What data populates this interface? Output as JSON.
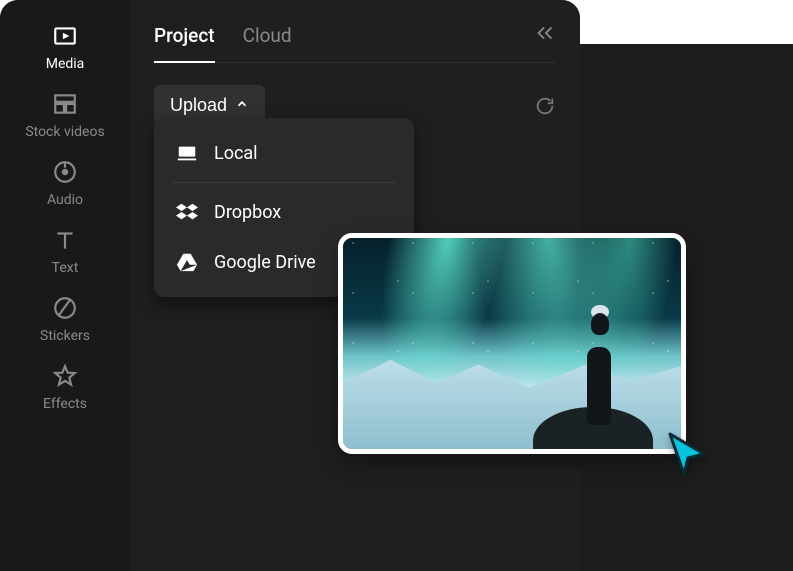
{
  "sidebar": {
    "items": [
      {
        "label": "Media",
        "icon": "media-icon",
        "active": true
      },
      {
        "label": "Stock videos",
        "icon": "stock-icon"
      },
      {
        "label": "Audio",
        "icon": "audio-icon"
      },
      {
        "label": "Text",
        "icon": "text-icon"
      },
      {
        "label": "Stickers",
        "icon": "stickers-icon"
      },
      {
        "label": "Effects",
        "icon": "effects-icon"
      }
    ]
  },
  "tabs": {
    "project": "Project",
    "cloud": "Cloud"
  },
  "toolbar": {
    "upload_label": "Upload"
  },
  "upload_menu": {
    "local": "Local",
    "dropbox": "Dropbox",
    "google_drive": "Google Drive"
  },
  "preview": {
    "alt": "aurora-photo"
  }
}
